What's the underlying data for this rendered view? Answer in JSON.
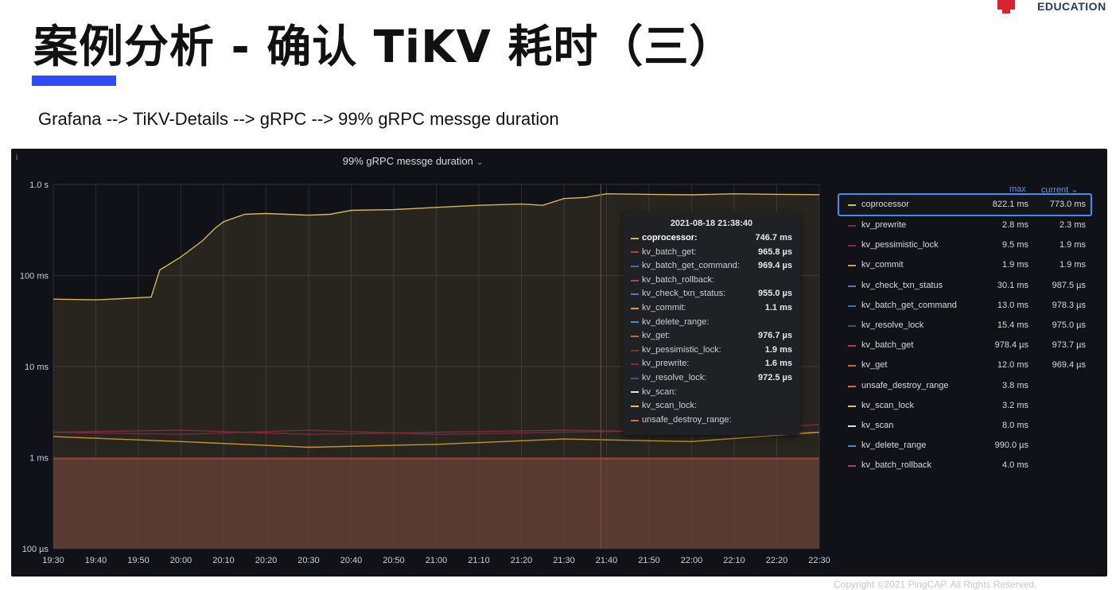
{
  "slide": {
    "title": "案例分析 - 确认 TiKV 耗时（三）",
    "subtitle": "Grafana --> TiKV-Details --> gRPC --> 99% gRPC messge duration",
    "logo_text": "EDUCATION",
    "footer": "Copyright ©2021 PingCAP. All Rights Reserved."
  },
  "panel": {
    "info_icon": "i",
    "title": "99% gRPC messge duration",
    "title_chevron": "chevron-down-icon"
  },
  "tooltip": {
    "time": "2021-08-18 21:38:40",
    "rows": [
      {
        "name": "coprocessor:",
        "value": "746.7 ms",
        "color": "#d6b45a"
      },
      {
        "name": "kv_batch_get:",
        "value": "965.8 µs",
        "color": "#b8403c"
      },
      {
        "name": "kv_batch_get_command:",
        "value": "969.4 µs",
        "color": "#3b6fb0"
      },
      {
        "name": "kv_batch_rollback:",
        "value": "",
        "color": "#a0447a"
      },
      {
        "name": "kv_check_txn_status:",
        "value": "955.0 µs",
        "color": "#6b6fb8"
      },
      {
        "name": "kv_commit:",
        "value": "1.1 ms",
        "color": "#d6a02c"
      },
      {
        "name": "kv_delete_range:",
        "value": "",
        "color": "#4a8dcc"
      },
      {
        "name": "kv_get:",
        "value": "976.7 µs",
        "color": "#c26b2f"
      },
      {
        "name": "kv_pessimistic_lock:",
        "value": "1.9 ms",
        "color": "#8a2b37"
      },
      {
        "name": "kv_prewrite:",
        "value": "1.6 ms",
        "color": "#7a2c49"
      },
      {
        "name": "kv_resolve_lock:",
        "value": "972.5 µs",
        "color": "#494e7a"
      },
      {
        "name": "kv_scan:",
        "value": "",
        "color": "#e0e0e0"
      },
      {
        "name": "kv_scan_lock:",
        "value": "",
        "color": "#e6c24a"
      },
      {
        "name": "unsafe_destroy_range:",
        "value": "",
        "color": "#d8674a"
      }
    ]
  },
  "legend": {
    "col_max": "max",
    "col_current": "current",
    "sort_icon": "chevron-down-icon",
    "items": [
      {
        "name": "coprocessor",
        "max": "822.1 ms",
        "current": "773.0 ms",
        "color": "#d6b45a"
      },
      {
        "name": "kv_prewrite",
        "max": "2.8 ms",
        "current": "2.3 ms",
        "color": "#7a2c49"
      },
      {
        "name": "kv_pessimistic_lock",
        "max": "9.5 ms",
        "current": "1.9 ms",
        "color": "#8a2b37"
      },
      {
        "name": "kv_commit",
        "max": "1.9 ms",
        "current": "1.9 ms",
        "color": "#d6a02c"
      },
      {
        "name": "kv_check_txn_status",
        "max": "30.1 ms",
        "current": "987.5 µs",
        "color": "#6b6fb8"
      },
      {
        "name": "kv_batch_get_command",
        "max": "13.0 ms",
        "current": "978.3 µs",
        "color": "#3b6fb0"
      },
      {
        "name": "kv_resolve_lock",
        "max": "15.4 ms",
        "current": "975.0 µs",
        "color": "#494e7a"
      },
      {
        "name": "kv_batch_get",
        "max": "978.4 µs",
        "current": "973.7 µs",
        "color": "#b8403c"
      },
      {
        "name": "kv_get",
        "max": "12.0 ms",
        "current": "969.4 µs",
        "color": "#c26b2f"
      },
      {
        "name": "unsafe_destroy_range",
        "max": "3.8 ms",
        "current": "",
        "color": "#d8674a"
      },
      {
        "name": "kv_scan_lock",
        "max": "3.2 ms",
        "current": "",
        "color": "#e6c24a"
      },
      {
        "name": "kv_scan",
        "max": "8.0 ms",
        "current": "",
        "color": "#e0e0e0"
      },
      {
        "name": "kv_delete_range",
        "max": "990.0 µs",
        "current": "",
        "color": "#4a8dcc"
      },
      {
        "name": "kv_batch_rollback",
        "max": "4.0 ms",
        "current": "",
        "color": "#a0447a"
      }
    ]
  },
  "chart_data": {
    "type": "line",
    "title": "99% gRPC messge duration",
    "y_scale": "log",
    "ylim_seconds": [
      0.0001,
      1
    ],
    "y_ticks": [
      {
        "label": "1.0 s",
        "value": 1
      },
      {
        "label": "100 ms",
        "value": 0.1
      },
      {
        "label": "10 ms",
        "value": 0.01
      },
      {
        "label": "1 ms",
        "value": 0.001
      },
      {
        "label": "100 µs",
        "value": 0.0001
      }
    ],
    "x_ticks": [
      "19:30",
      "19:40",
      "19:50",
      "20:00",
      "20:10",
      "20:20",
      "20:30",
      "20:40",
      "20:50",
      "21:00",
      "21:10",
      "21:20",
      "21:30",
      "21:40",
      "21:50",
      "22:00",
      "22:10",
      "22:20",
      "22:30"
    ],
    "grid": true,
    "legend_position": "right",
    "hover_time": "21:38:40",
    "series": [
      {
        "name": "coprocessor",
        "color": "#d6b45a",
        "x": [
          "19:30",
          "19:40",
          "19:50",
          "19:53",
          "19:55",
          "20:00",
          "20:05",
          "20:08",
          "20:10",
          "20:15",
          "20:20",
          "20:30",
          "20:35",
          "20:40",
          "20:50",
          "21:00",
          "21:10",
          "21:20",
          "21:25",
          "21:30",
          "21:35",
          "21:40",
          "21:50",
          "22:00",
          "22:10",
          "22:20",
          "22:30"
        ],
        "y_ms": [
          55,
          54,
          57,
          58,
          115,
          160,
          240,
          330,
          390,
          470,
          480,
          460,
          470,
          520,
          530,
          560,
          590,
          610,
          590,
          700,
          720,
          790,
          780,
          770,
          790,
          780,
          773
        ]
      },
      {
        "name": "kv_prewrite",
        "color": "#7a2c49",
        "x": [
          "19:30",
          "20:00",
          "20:30",
          "21:00",
          "21:30",
          "22:00",
          "22:30"
        ],
        "y_ms": [
          1.9,
          1.8,
          2.0,
          1.8,
          1.9,
          2.0,
          2.3
        ]
      },
      {
        "name": "kv_pessimistic_lock",
        "color": "#8a2b37",
        "x": [
          "19:30",
          "20:00",
          "20:30",
          "21:00",
          "21:30",
          "22:00",
          "22:30"
        ],
        "y_ms": [
          1.9,
          2.0,
          1.8,
          1.9,
          2.0,
          1.9,
          1.9
        ]
      },
      {
        "name": "kv_commit",
        "color": "#d6a02c",
        "x": [
          "19:30",
          "20:00",
          "20:30",
          "21:00",
          "21:30",
          "22:00",
          "22:30"
        ],
        "y_ms": [
          1.7,
          1.5,
          1.3,
          1.4,
          1.6,
          1.5,
          1.9
        ]
      },
      {
        "name": "kv_batch_get",
        "color": "#b8403c",
        "x": [
          "19:30",
          "20:00",
          "20:30",
          "21:00",
          "21:30",
          "22:00",
          "22:30"
        ],
        "y_ms": [
          0.97,
          0.97,
          0.97,
          0.97,
          0.97,
          0.97,
          0.97
        ]
      }
    ]
  }
}
